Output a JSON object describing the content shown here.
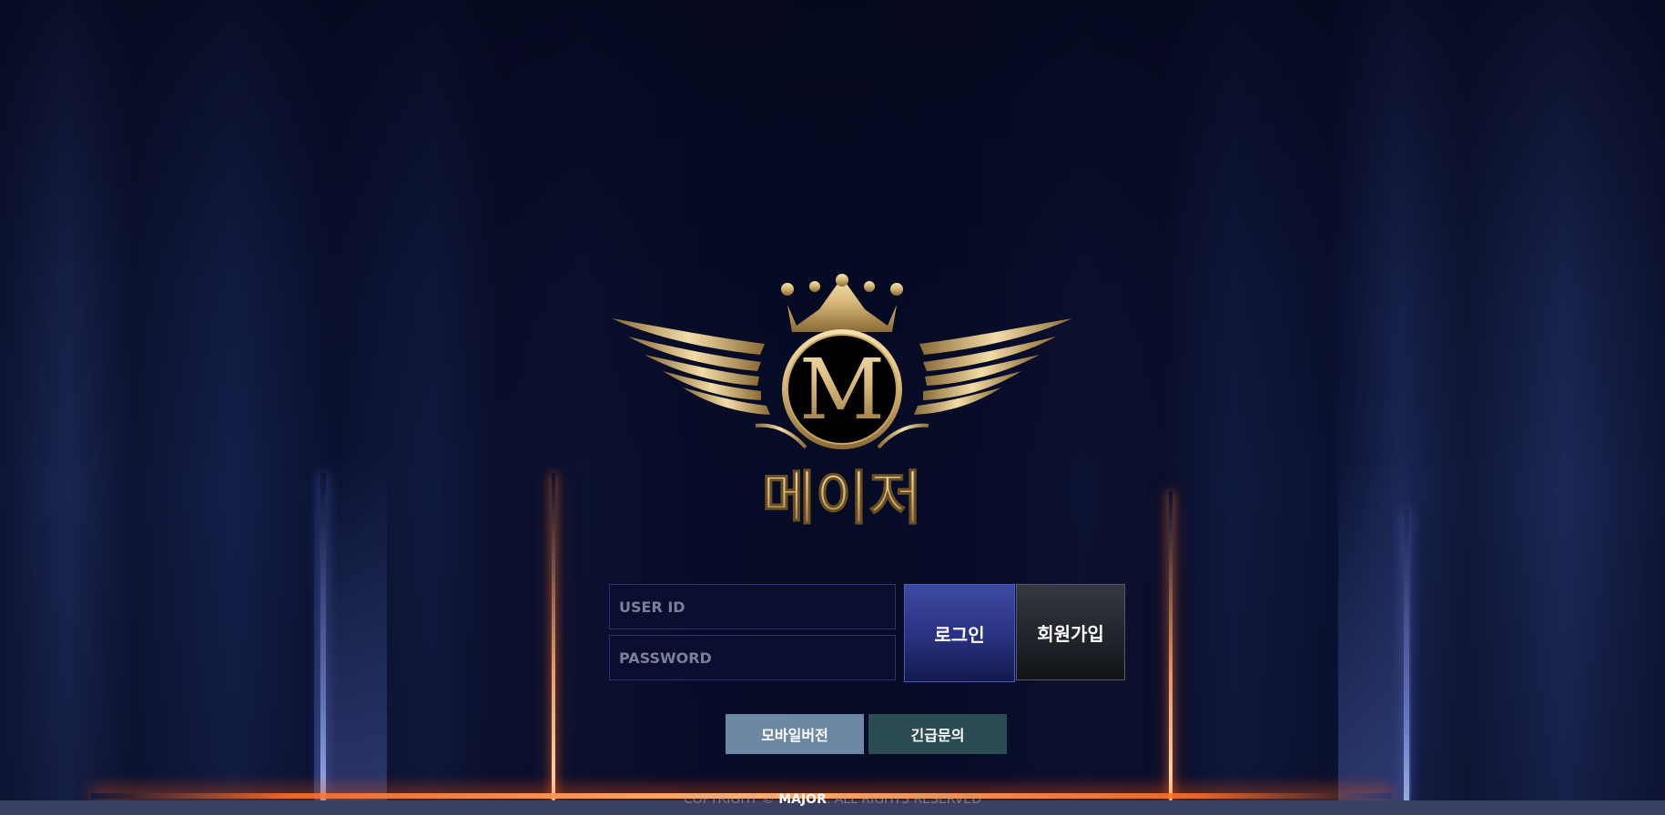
{
  "logo": {
    "monogram": "M",
    "brand_name": "메이저"
  },
  "login": {
    "userid_placeholder": "USER ID",
    "password_placeholder": "PASSWORD",
    "login_label": "로그인",
    "signup_label": "회원가입"
  },
  "links": {
    "mobile_label": "모바일버전",
    "emergency_label": "긴급문의"
  },
  "footer": {
    "prefix": "COPYRIGHT ©",
    "brand": "MAJOR",
    "suffix": ". ALL RIGHTS RESERVED"
  },
  "colors": {
    "background": "#080d2a",
    "gold": "#d8b778",
    "login_button": "#2a3383",
    "signup_button": "#202329",
    "mobile_button": "#6e88a3",
    "emergency_button": "#2b4c52"
  }
}
